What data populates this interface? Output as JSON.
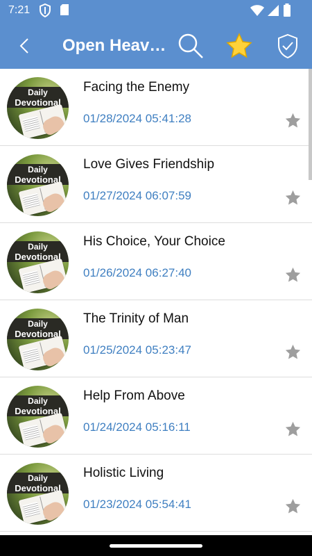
{
  "status_bar": {
    "time": "7:21",
    "left_icons": [
      "shield-status-icon",
      "sd-card-icon"
    ],
    "right_icons": [
      "wifi-icon",
      "signal-icon",
      "battery-icon"
    ]
  },
  "toolbar": {
    "title": "Open Heav…",
    "icons": [
      "back-arrow-icon",
      "search-icon",
      "star-favorites-icon",
      "shield-check-icon"
    ]
  },
  "colors": {
    "appbar": "#5b8fcf",
    "date_text": "#3f7fc1",
    "star_inactive": "#9e9e9e",
    "star_active": "#ffd23a"
  },
  "thumbnail": {
    "line1": "Daily",
    "line2": "Devotional"
  },
  "items": [
    {
      "title": "Facing the Enemy",
      "date": "01/28/2024 05:41:28"
    },
    {
      "title": "Love Gives Friendship",
      "date": "01/27/2024 06:07:59"
    },
    {
      "title": "His Choice, Your Choice",
      "date": "01/26/2024 06:27:40"
    },
    {
      "title": "The Trinity of Man",
      "date": "01/25/2024 05:23:47"
    },
    {
      "title": "Help From Above",
      "date": "01/24/2024 05:16:11"
    },
    {
      "title": "Holistic Living",
      "date": "01/23/2024 05:54:41"
    }
  ]
}
